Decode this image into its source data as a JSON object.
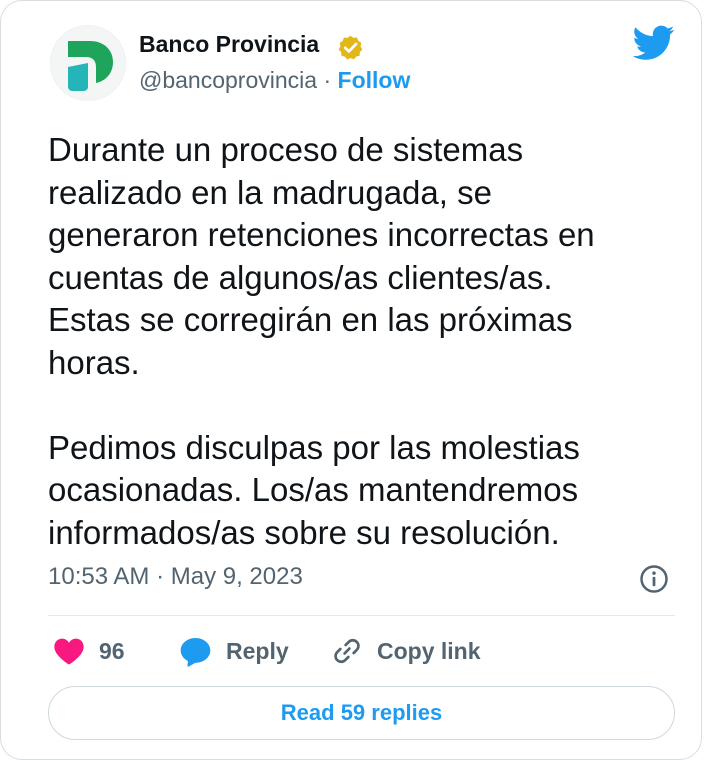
{
  "author": {
    "name": "Banco Provincia",
    "handle": "@bancoprovincia",
    "separator": " · ",
    "follow_label": "Follow",
    "verified_badge_color": "#e2b719",
    "avatar_colors": {
      "green": "#1ea55b",
      "teal": "#25b5b8"
    }
  },
  "tweet": {
    "text": "Durante un proceso de sistemas\nrealizado en la madrugada, se\ngeneraron retenciones incorrectas en\ncuentas de algunos/as clientes/as.\nEstas se corregirán en las próximas\nhoras.\n\nPedimos disculpas por las molestias\nocasionadas. Los/as mantendremos\ninformados/as sobre su resolución.",
    "timestamp": "10:53 AM · May 9, 2023"
  },
  "actions": {
    "like_count": "96",
    "reply_label": "Reply",
    "copy_link_label": "Copy link"
  },
  "read_replies_label": "Read 59 replies",
  "colors": {
    "accent": "#1d9bf0",
    "like": "#f91880",
    "text": "#0f1419",
    "muted": "#536471"
  },
  "icons": {
    "logo": "twitter-bird-icon",
    "info": "info-icon",
    "like": "heart-icon",
    "reply": "speech-bubble-icon",
    "copy": "link-icon",
    "badge": "verified-badge-icon"
  }
}
